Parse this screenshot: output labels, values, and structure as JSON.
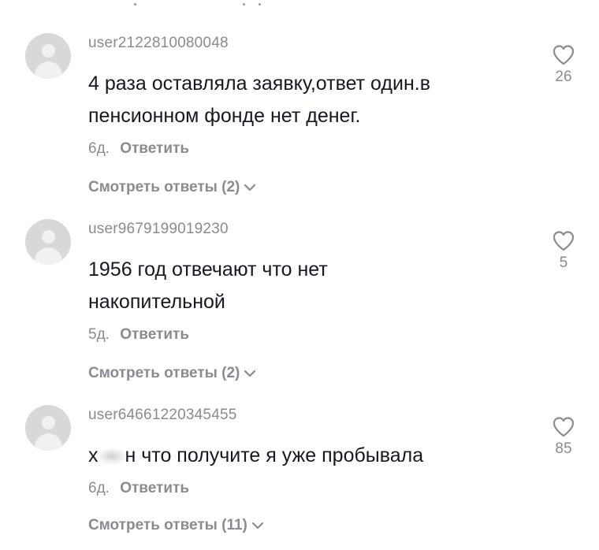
{
  "comments": [
    {
      "username": "user2122810080048",
      "text": "4 раза оставляла заявку,ответ один.в пенсионном фонде нет денег.",
      "age": "6д.",
      "reply_label": "Ответить",
      "view_replies": "Смотреть ответы (2)",
      "likes": "26"
    },
    {
      "username": "user9679199019230",
      "text": "1956 год отвечают что нет накопительной",
      "age": "5д.",
      "reply_label": "Ответить",
      "view_replies": "Смотреть ответы (2)",
      "likes": "5"
    },
    {
      "username": "user64661220345455",
      "text_before_blur": "х",
      "text_after_blur": "н что получите я уже пробывала",
      "age": "6д.",
      "reply_label": "Ответить",
      "view_replies": "Смотреть ответы (11)",
      "likes": "85"
    }
  ],
  "icons": {
    "avatar": "default-avatar-icon",
    "like": "heart-outline-icon",
    "expand": "chevron-down-icon"
  },
  "colors": {
    "text": "#161823",
    "secondary": "#8a8b91",
    "avatar_bg": "#d8d8d8"
  }
}
